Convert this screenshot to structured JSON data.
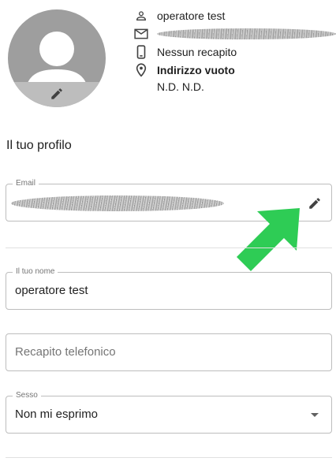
{
  "header": {
    "user_name": "operatore test",
    "email_value": "",
    "phone": "Nessun recapito",
    "address_title": "Indirizzo vuoto",
    "address_line": "N.D. N.D."
  },
  "section_title": "Il tuo profilo",
  "fields": {
    "email": {
      "label": "Email",
      "value": ""
    },
    "name": {
      "label": "Il tuo nome",
      "value": "operatore test"
    },
    "phone": {
      "placeholder": "Recapito telefonico",
      "value": ""
    },
    "sex": {
      "label": "Sesso",
      "value": "Non mi esprimo"
    }
  },
  "colors": {
    "avatar_bg": "#9e9e9e",
    "avatar_band": "#bdbdbd",
    "arrow": "#2ecc55",
    "border": "#bdbdbd"
  },
  "icons": [
    "person-icon",
    "mail-icon",
    "phone-icon",
    "location-icon",
    "edit-icon",
    "dropdown-arrow-icon"
  ]
}
